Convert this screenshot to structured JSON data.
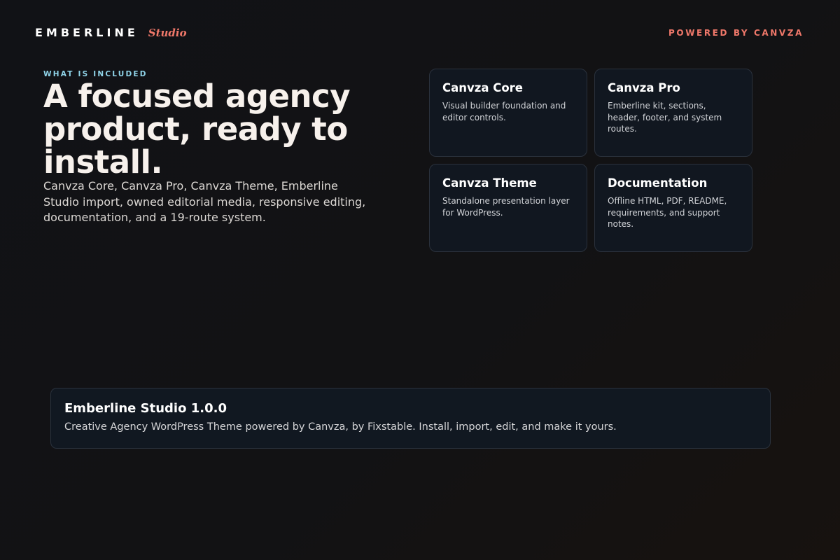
{
  "header": {
    "brand_name": "EMBERLINE",
    "brand_sub": "Studio",
    "powered_by": "POWERED BY CANVZA"
  },
  "hero": {
    "eyebrow": "WHAT IS INCLUDED",
    "headline": "A focused agency product, ready to install.",
    "lede": "Canvza Core, Canvza Pro, Canvza Theme, Emberline Studio import, owned editorial media, responsive editing, documentation, and a 19-route system."
  },
  "cards": [
    {
      "title": "Canvza Core",
      "desc": "Visual builder foundation and editor controls."
    },
    {
      "title": "Canvza Pro",
      "desc": "Emberline kit, sections, header, footer, and system routes."
    },
    {
      "title": "Canvza Theme",
      "desc": "Standalone presentation layer for WordPress."
    },
    {
      "title": "Documentation",
      "desc": "Offline HTML, PDF, README, requirements, and support notes."
    }
  ],
  "release": {
    "title": "Emberline Studio 1.0.0",
    "desc": "Creative Agency WordPress Theme powered by Canvza, by Fixstable. Install, import, edit, and make it yours."
  },
  "colors": {
    "accent": "#f0786a",
    "eyebrow": "#8fd3e8",
    "card_bg": "#111720",
    "page_bg": "#121214"
  }
}
